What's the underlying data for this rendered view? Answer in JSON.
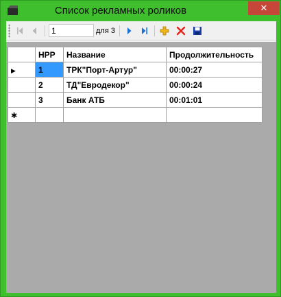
{
  "window": {
    "title": "Список рекламных роликов",
    "close_label": "✕"
  },
  "navigator": {
    "position": "1",
    "count_label": "для 3"
  },
  "grid": {
    "columns": [
      "НРР",
      "Название",
      "Продолжительность"
    ],
    "rows": [
      {
        "nrr": "1",
        "name": "ТРК\"Порт-Артур\"",
        "duration": "00:00:27"
      },
      {
        "nrr": "2",
        "name": "ТД\"Евродекор\"",
        "duration": "00:00:24"
      },
      {
        "nrr": "3",
        "name": "Банк АТБ",
        "duration": "00:01:01"
      }
    ],
    "new_row_marker": "✱",
    "current_row_marker": "▶"
  },
  "colors": {
    "desktop": "#3fbf2e",
    "selection": "#3399ff",
    "grid_background": "#aaaaaa",
    "close_button": "#c7463a"
  }
}
